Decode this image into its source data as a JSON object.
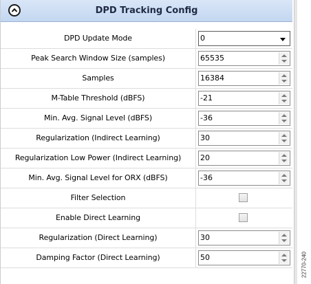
{
  "panel": {
    "title": "DPD Tracking Config"
  },
  "watermark": "22770-240",
  "rows": [
    {
      "label": "DPD Update Mode",
      "control": "select",
      "value": "0"
    },
    {
      "label": "Peak Search Window Size (samples)",
      "control": "spinner",
      "value": "65535"
    },
    {
      "label": "Samples",
      "control": "spinner",
      "value": "16384"
    },
    {
      "label": "M-Table Threshold (dBFS)",
      "control": "spinner",
      "value": "-21"
    },
    {
      "label": "Min. Avg. Signal Level (dBFS)",
      "control": "spinner",
      "value": "-36"
    },
    {
      "label": "Regularization (Indirect Learning)",
      "control": "spinner",
      "value": "30"
    },
    {
      "label": "Regularization Low Power (Indirect Learning)",
      "control": "spinner",
      "value": "20"
    },
    {
      "label": "Min. Avg. Signal Level for ORX (dBFS)",
      "control": "spinner",
      "value": "-36"
    },
    {
      "label": "Filter Selection",
      "control": "checkbox",
      "checked": false
    },
    {
      "label": "Enable Direct Learning",
      "control": "checkbox",
      "checked": false
    },
    {
      "label": "Regularization (Direct Learning)",
      "control": "spinner",
      "value": "30"
    },
    {
      "label": "Damping Factor (Direct Learning)",
      "control": "spinner",
      "value": "50"
    }
  ]
}
